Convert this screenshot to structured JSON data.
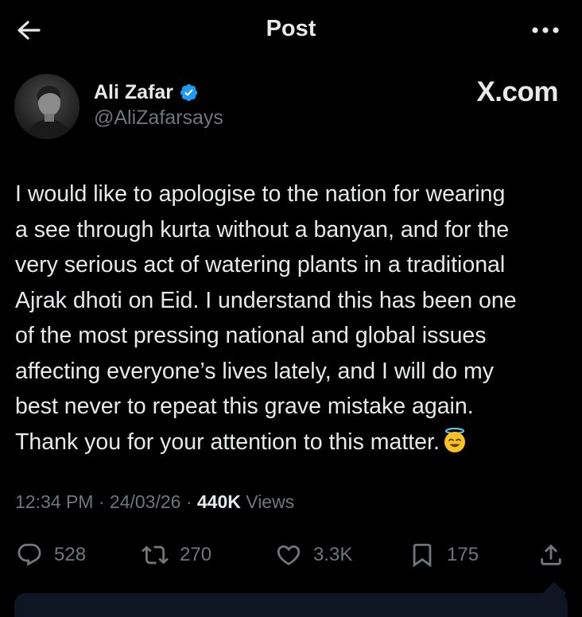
{
  "header": {
    "title": "Post"
  },
  "author": {
    "name": "Ali Zafar",
    "handle": "@AliZafarsays",
    "verified": true
  },
  "watermark": "X.com",
  "tweet": {
    "lines": [
      "I would like to apologise to the nation for wearing",
      "a see through kurta without a banyan, and for the",
      "very serious act of watering plants in a traditional",
      "Ajrak dhoti on Eid. I understand this has been one",
      "of the most pressing national and global issues",
      "affecting everyone’s lives lately, and I will do my",
      "best never to repeat this grave mistake again.",
      "Thank you for your attention to this matter."
    ],
    "emoji": "smiling-face-with-halo-emoji"
  },
  "meta": {
    "time": "12:34 PM",
    "separator": " · ",
    "date": "24/03/26",
    "views_count": "440K",
    "views_label": " Views"
  },
  "actions": {
    "replies": "528",
    "reposts": "270",
    "likes": "3.3K",
    "bookmarks": "175"
  },
  "colors": {
    "background": "#000000",
    "text": "#e7e9ea",
    "secondary": "#71767b",
    "verified": "#1d9bf0"
  }
}
